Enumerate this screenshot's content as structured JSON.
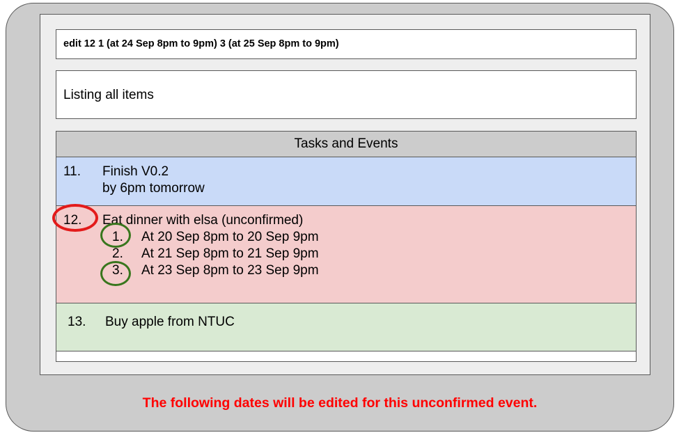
{
  "command": {
    "value": "edit 12 1 (at 24 Sep 8pm to 9pm) 3 (at 25 Sep 8pm to 9pm)"
  },
  "result": {
    "message": "Listing all items"
  },
  "list": {
    "header": "Tasks and Events",
    "items": [
      {
        "index": "11.",
        "title": "Finish V0.2",
        "detail": "by 6pm tomorrow",
        "color": "#c9daf8"
      },
      {
        "index": "12.",
        "title": "Eat dinner with elsa (unconfirmed)",
        "color": "#f4cccc",
        "slots": [
          {
            "number": "1.",
            "text": "At 20 Sep 8pm to 20 Sep 9pm",
            "highlighted": true
          },
          {
            "number": "2.",
            "text": "At 21 Sep 8pm to 21 Sep 9pm",
            "highlighted": false
          },
          {
            "number": "3.",
            "text": "At 23 Sep 8pm to 23 Sep 9pm",
            "highlighted": true
          }
        ]
      },
      {
        "index": "13.",
        "title": "Buy apple from NTUC",
        "color": "#d9ead3"
      }
    ]
  },
  "annotation": {
    "note": "The following dates will be edited for this unconfirmed event.",
    "index_circle_color": "#e31b1b",
    "slot_circle_color": "#38761d",
    "note_color": "#ff0000"
  }
}
